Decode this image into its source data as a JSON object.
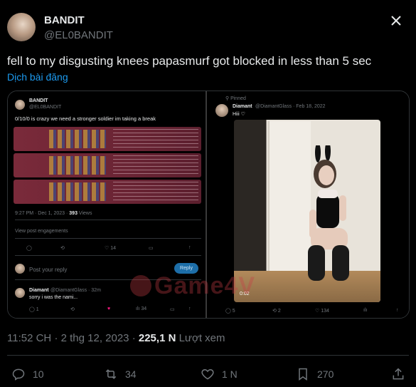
{
  "tweet": {
    "author_name": "BANDIT",
    "author_handle": "@EL0BANDIT",
    "text": "fell to my disgusting knees papasmurf got blocked in less than 5 sec",
    "translate_label": "Dịch bài đăng",
    "time": "11:52 CH",
    "date": "2 thg 12, 2023",
    "separator": "·",
    "views_count": "225,1 N",
    "views_label": "Lượt xem"
  },
  "embedded_left": {
    "author_name": "BANDIT",
    "author_handle": "@EL0BANDIT",
    "text": "0/10/0 is crazy we need a stronger soldier im taking a break",
    "timestamp": "9:27 PM · Dec 1, 2023 ·",
    "views": "393",
    "views_label": "Views",
    "engagements": "View post engagements",
    "like_count": "14",
    "reply_placeholder": "Post your reply",
    "reply_button": "Reply",
    "reply_author": "Diamant",
    "reply_handle": "@DiamantGlass · 32m",
    "reply_text": "sorry i was the nami...",
    "reply_reply_count": "1",
    "reply_like_count": "34"
  },
  "embedded_right": {
    "pinned_label": "Pinned",
    "author_name": "Diamant",
    "author_handle": "@DiamantGlass · Feb 18, 2022",
    "text": "Hiii",
    "video_time": "0:02",
    "reply_count": "5",
    "repost_count": "2",
    "like_count": "134"
  },
  "watermark": "Game4V",
  "actions": {
    "reply_count": "10",
    "repost_count": "34",
    "like_count": "1 N",
    "bookmark_count": "270"
  },
  "icons": {
    "close": "close-icon",
    "reply": "reply-icon",
    "repost": "repost-icon",
    "like": "heart-icon",
    "bookmark": "bookmark-icon",
    "share": "share-icon"
  }
}
